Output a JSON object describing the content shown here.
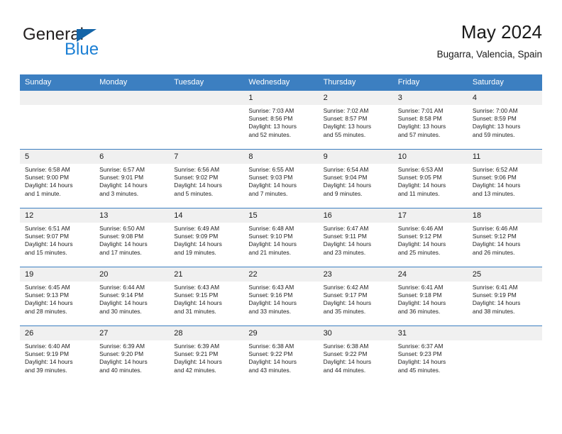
{
  "brand": {
    "word_one": "General",
    "word_two": "Blue",
    "triangle_color": "#1565a8",
    "blue_color": "#1b7fd4"
  },
  "header": {
    "title": "May 2024",
    "subtitle": "Bugarra, Valencia, Spain"
  },
  "theme": {
    "header_blue": "#3c7fc1",
    "daynum_band": "#f0f0f0",
    "text": "#1a1a1a"
  },
  "weekday_headers": [
    "Sunday",
    "Monday",
    "Tuesday",
    "Wednesday",
    "Thursday",
    "Friday",
    "Saturday"
  ],
  "weeks": [
    [
      {
        "day": "",
        "sunrise": "",
        "sunset": "",
        "daylight_line1": "",
        "daylight_line2": ""
      },
      {
        "day": "",
        "sunrise": "",
        "sunset": "",
        "daylight_line1": "",
        "daylight_line2": ""
      },
      {
        "day": "",
        "sunrise": "",
        "sunset": "",
        "daylight_line1": "",
        "daylight_line2": ""
      },
      {
        "day": "1",
        "sunrise": "Sunrise: 7:03 AM",
        "sunset": "Sunset: 8:56 PM",
        "daylight_line1": "Daylight: 13 hours",
        "daylight_line2": "and 52 minutes."
      },
      {
        "day": "2",
        "sunrise": "Sunrise: 7:02 AM",
        "sunset": "Sunset: 8:57 PM",
        "daylight_line1": "Daylight: 13 hours",
        "daylight_line2": "and 55 minutes."
      },
      {
        "day": "3",
        "sunrise": "Sunrise: 7:01 AM",
        "sunset": "Sunset: 8:58 PM",
        "daylight_line1": "Daylight: 13 hours",
        "daylight_line2": "and 57 minutes."
      },
      {
        "day": "4",
        "sunrise": "Sunrise: 7:00 AM",
        "sunset": "Sunset: 8:59 PM",
        "daylight_line1": "Daylight: 13 hours",
        "daylight_line2": "and 59 minutes."
      }
    ],
    [
      {
        "day": "5",
        "sunrise": "Sunrise: 6:58 AM",
        "sunset": "Sunset: 9:00 PM",
        "daylight_line1": "Daylight: 14 hours",
        "daylight_line2": "and 1 minute."
      },
      {
        "day": "6",
        "sunrise": "Sunrise: 6:57 AM",
        "sunset": "Sunset: 9:01 PM",
        "daylight_line1": "Daylight: 14 hours",
        "daylight_line2": "and 3 minutes."
      },
      {
        "day": "7",
        "sunrise": "Sunrise: 6:56 AM",
        "sunset": "Sunset: 9:02 PM",
        "daylight_line1": "Daylight: 14 hours",
        "daylight_line2": "and 5 minutes."
      },
      {
        "day": "8",
        "sunrise": "Sunrise: 6:55 AM",
        "sunset": "Sunset: 9:03 PM",
        "daylight_line1": "Daylight: 14 hours",
        "daylight_line2": "and 7 minutes."
      },
      {
        "day": "9",
        "sunrise": "Sunrise: 6:54 AM",
        "sunset": "Sunset: 9:04 PM",
        "daylight_line1": "Daylight: 14 hours",
        "daylight_line2": "and 9 minutes."
      },
      {
        "day": "10",
        "sunrise": "Sunrise: 6:53 AM",
        "sunset": "Sunset: 9:05 PM",
        "daylight_line1": "Daylight: 14 hours",
        "daylight_line2": "and 11 minutes."
      },
      {
        "day": "11",
        "sunrise": "Sunrise: 6:52 AM",
        "sunset": "Sunset: 9:06 PM",
        "daylight_line1": "Daylight: 14 hours",
        "daylight_line2": "and 13 minutes."
      }
    ],
    [
      {
        "day": "12",
        "sunrise": "Sunrise: 6:51 AM",
        "sunset": "Sunset: 9:07 PM",
        "daylight_line1": "Daylight: 14 hours",
        "daylight_line2": "and 15 minutes."
      },
      {
        "day": "13",
        "sunrise": "Sunrise: 6:50 AM",
        "sunset": "Sunset: 9:08 PM",
        "daylight_line1": "Daylight: 14 hours",
        "daylight_line2": "and 17 minutes."
      },
      {
        "day": "14",
        "sunrise": "Sunrise: 6:49 AM",
        "sunset": "Sunset: 9:09 PM",
        "daylight_line1": "Daylight: 14 hours",
        "daylight_line2": "and 19 minutes."
      },
      {
        "day": "15",
        "sunrise": "Sunrise: 6:48 AM",
        "sunset": "Sunset: 9:10 PM",
        "daylight_line1": "Daylight: 14 hours",
        "daylight_line2": "and 21 minutes."
      },
      {
        "day": "16",
        "sunrise": "Sunrise: 6:47 AM",
        "sunset": "Sunset: 9:11 PM",
        "daylight_line1": "Daylight: 14 hours",
        "daylight_line2": "and 23 minutes."
      },
      {
        "day": "17",
        "sunrise": "Sunrise: 6:46 AM",
        "sunset": "Sunset: 9:12 PM",
        "daylight_line1": "Daylight: 14 hours",
        "daylight_line2": "and 25 minutes."
      },
      {
        "day": "18",
        "sunrise": "Sunrise: 6:46 AM",
        "sunset": "Sunset: 9:12 PM",
        "daylight_line1": "Daylight: 14 hours",
        "daylight_line2": "and 26 minutes."
      }
    ],
    [
      {
        "day": "19",
        "sunrise": "Sunrise: 6:45 AM",
        "sunset": "Sunset: 9:13 PM",
        "daylight_line1": "Daylight: 14 hours",
        "daylight_line2": "and 28 minutes."
      },
      {
        "day": "20",
        "sunrise": "Sunrise: 6:44 AM",
        "sunset": "Sunset: 9:14 PM",
        "daylight_line1": "Daylight: 14 hours",
        "daylight_line2": "and 30 minutes."
      },
      {
        "day": "21",
        "sunrise": "Sunrise: 6:43 AM",
        "sunset": "Sunset: 9:15 PM",
        "daylight_line1": "Daylight: 14 hours",
        "daylight_line2": "and 31 minutes."
      },
      {
        "day": "22",
        "sunrise": "Sunrise: 6:43 AM",
        "sunset": "Sunset: 9:16 PM",
        "daylight_line1": "Daylight: 14 hours",
        "daylight_line2": "and 33 minutes."
      },
      {
        "day": "23",
        "sunrise": "Sunrise: 6:42 AM",
        "sunset": "Sunset: 9:17 PM",
        "daylight_line1": "Daylight: 14 hours",
        "daylight_line2": "and 35 minutes."
      },
      {
        "day": "24",
        "sunrise": "Sunrise: 6:41 AM",
        "sunset": "Sunset: 9:18 PM",
        "daylight_line1": "Daylight: 14 hours",
        "daylight_line2": "and 36 minutes."
      },
      {
        "day": "25",
        "sunrise": "Sunrise: 6:41 AM",
        "sunset": "Sunset: 9:19 PM",
        "daylight_line1": "Daylight: 14 hours",
        "daylight_line2": "and 38 minutes."
      }
    ],
    [
      {
        "day": "26",
        "sunrise": "Sunrise: 6:40 AM",
        "sunset": "Sunset: 9:19 PM",
        "daylight_line1": "Daylight: 14 hours",
        "daylight_line2": "and 39 minutes."
      },
      {
        "day": "27",
        "sunrise": "Sunrise: 6:39 AM",
        "sunset": "Sunset: 9:20 PM",
        "daylight_line1": "Daylight: 14 hours",
        "daylight_line2": "and 40 minutes."
      },
      {
        "day": "28",
        "sunrise": "Sunrise: 6:39 AM",
        "sunset": "Sunset: 9:21 PM",
        "daylight_line1": "Daylight: 14 hours",
        "daylight_line2": "and 42 minutes."
      },
      {
        "day": "29",
        "sunrise": "Sunrise: 6:38 AM",
        "sunset": "Sunset: 9:22 PM",
        "daylight_line1": "Daylight: 14 hours",
        "daylight_line2": "and 43 minutes."
      },
      {
        "day": "30",
        "sunrise": "Sunrise: 6:38 AM",
        "sunset": "Sunset: 9:22 PM",
        "daylight_line1": "Daylight: 14 hours",
        "daylight_line2": "and 44 minutes."
      },
      {
        "day": "31",
        "sunrise": "Sunrise: 6:37 AM",
        "sunset": "Sunset: 9:23 PM",
        "daylight_line1": "Daylight: 14 hours",
        "daylight_line2": "and 45 minutes."
      },
      {
        "day": "",
        "sunrise": "",
        "sunset": "",
        "daylight_line1": "",
        "daylight_line2": ""
      }
    ]
  ]
}
